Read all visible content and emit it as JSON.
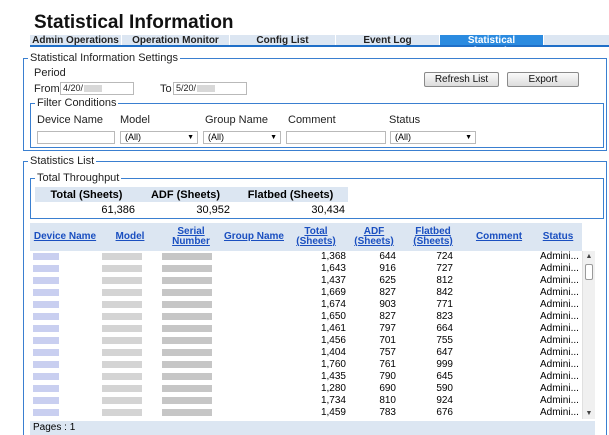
{
  "page_title": "Statistical Information",
  "tabs": [
    {
      "label": "Admin Operations"
    },
    {
      "label": "Operation Monitor"
    },
    {
      "label": "Config List"
    },
    {
      "label": "Event Log"
    },
    {
      "label": "Statistical Information",
      "active": true
    }
  ],
  "settings": {
    "legend": "Statistical Information Settings",
    "period_label": "Period",
    "from_label": "From",
    "from_value": "4/20/",
    "to_label": "To",
    "to_value": "5/20/",
    "refresh_label": "Refresh List",
    "export_label": "Export"
  },
  "filter": {
    "legend": "Filter Conditions",
    "device_name_label": "Device Name",
    "model_label": "Model",
    "model_value": "(All)",
    "group_name_label": "Group Name",
    "group_name_value": "(All)",
    "comment_label": "Comment",
    "status_label": "Status",
    "status_value": "(All)"
  },
  "stats_list": {
    "legend": "Statistics List",
    "throughput": {
      "legend": "Total Throughput",
      "headers": [
        "Total (Sheets)",
        "ADF (Sheets)",
        "Flatbed (Sheets)"
      ],
      "values": [
        "61,386",
        "30,952",
        "30,434"
      ]
    },
    "columns": {
      "device_name": "Device Name",
      "model": "Model",
      "serial_1": "Serial",
      "serial_2": "Number",
      "group_name": "Group Name",
      "total_1": "Total",
      "total_2": "(Sheets)",
      "adf_1": "ADF",
      "adf_2": "(Sheets)",
      "flatbed_1": "Flatbed",
      "flatbed_2": "(Sheets)",
      "comment": "Comment",
      "status": "Status"
    },
    "rows": [
      {
        "total": "1,368",
        "adf": "644",
        "flatbed": "724",
        "status": "Admini..."
      },
      {
        "total": "1,643",
        "adf": "916",
        "flatbed": "727",
        "status": "Admini..."
      },
      {
        "total": "1,437",
        "adf": "625",
        "flatbed": "812",
        "status": "Admini..."
      },
      {
        "total": "1,669",
        "adf": "827",
        "flatbed": "842",
        "status": "Admini..."
      },
      {
        "total": "1,674",
        "adf": "903",
        "flatbed": "771",
        "status": "Admini..."
      },
      {
        "total": "1,650",
        "adf": "827",
        "flatbed": "823",
        "status": "Admini..."
      },
      {
        "total": "1,461",
        "adf": "797",
        "flatbed": "664",
        "status": "Admini..."
      },
      {
        "total": "1,456",
        "adf": "701",
        "flatbed": "755",
        "status": "Admini..."
      },
      {
        "total": "1,404",
        "adf": "757",
        "flatbed": "647",
        "status": "Admini..."
      },
      {
        "total": "1,760",
        "adf": "761",
        "flatbed": "999",
        "status": "Admini..."
      },
      {
        "total": "1,435",
        "adf": "790",
        "flatbed": "645",
        "status": "Admini..."
      },
      {
        "total": "1,280",
        "adf": "690",
        "flatbed": "590",
        "status": "Admini..."
      },
      {
        "total": "1,734",
        "adf": "810",
        "flatbed": "924",
        "status": "Admini..."
      },
      {
        "total": "1,459",
        "adf": "783",
        "flatbed": "676",
        "status": "Admini..."
      }
    ],
    "pages_text": "Pages : 1"
  },
  "colors": {
    "accent": "#2b8be0",
    "border": "#3a7fd0",
    "header_bg": "#dce6f2",
    "link": "#1a4fc0"
  }
}
